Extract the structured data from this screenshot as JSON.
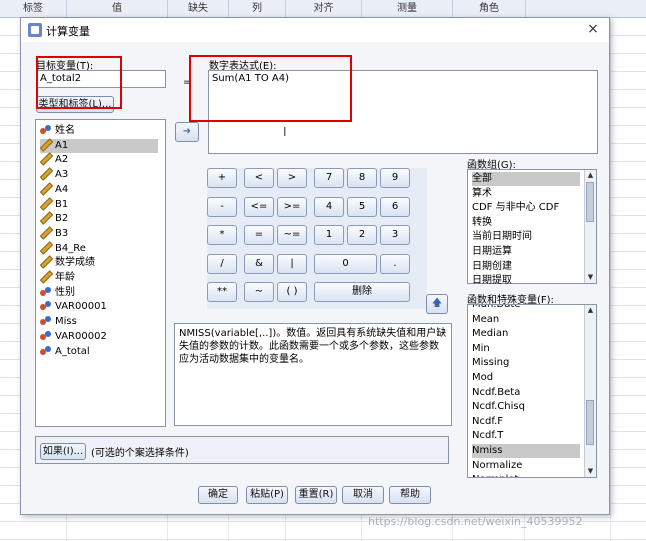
{
  "background": {
    "columns": [
      "标签",
      "值",
      "缺失",
      "列",
      "对齐",
      "测量",
      "角色"
    ]
  },
  "dialog": {
    "title": "计算变量",
    "close_icon": "×",
    "target_label": "目标变量(T):",
    "target_value": "A_total2",
    "type_label_button": "类型和标签(L)...",
    "equals": "=",
    "expression_label": "数字表达式(E):",
    "expression_value": "Sum(A1 TO A4)",
    "transfer_arrow": "➜",
    "variables": [
      {
        "name": "姓名",
        "icon": "nominal-icon",
        "selected": false
      },
      {
        "name": "A1",
        "icon": "scale-icon",
        "selected": true
      },
      {
        "name": "A2",
        "icon": "scale-icon",
        "selected": false
      },
      {
        "name": "A3",
        "icon": "scale-icon",
        "selected": false
      },
      {
        "name": "A4",
        "icon": "scale-icon",
        "selected": false
      },
      {
        "name": "B1",
        "icon": "scale-icon",
        "selected": false
      },
      {
        "name": "B2",
        "icon": "scale-icon",
        "selected": false
      },
      {
        "name": "B3",
        "icon": "scale-icon",
        "selected": false
      },
      {
        "name": "B4_Re",
        "icon": "scale-icon",
        "selected": false
      },
      {
        "name": "数学成绩",
        "icon": "scale-icon",
        "selected": false
      },
      {
        "name": "年龄",
        "icon": "scale-icon",
        "selected": false
      },
      {
        "name": "性别",
        "icon": "nominal-icon",
        "selected": false
      },
      {
        "name": "VAR00001",
        "icon": "nominal-icon",
        "selected": false
      },
      {
        "name": "Miss",
        "icon": "nominal-icon",
        "selected": false
      },
      {
        "name": "VAR00002",
        "icon": "nominal-icon",
        "selected": false
      },
      {
        "name": "A_total",
        "icon": "nominal-icon",
        "selected": false
      }
    ],
    "calculator": {
      "rows": [
        [
          "+",
          "<",
          ">",
          "7",
          "8",
          "9"
        ],
        [
          "-",
          "<=",
          ">=",
          "4",
          "5",
          "6"
        ],
        [
          "*",
          "=",
          "~=",
          "1",
          "2",
          "3"
        ],
        [
          "/",
          "&",
          "|",
          "0",
          "."
        ],
        [
          "**",
          "~",
          "( )",
          "删除"
        ]
      ]
    },
    "up_arrow": "🡅",
    "function_group_label": "函数组(G):",
    "function_groups": [
      "全部",
      "算术",
      "CDF 与非中心 CDF",
      "转换",
      "当前日期时间",
      "日期运算",
      "日期创建",
      "日期提取"
    ],
    "function_list_label": "函数和特殊变量(F):",
    "functions": [
      "Mdn.Date",
      "Mean",
      "Median",
      "Min",
      "Missing",
      "Mod",
      "Ncdf.Beta",
      "Ncdf.Chisq",
      "Ncdf.F",
      "Ncdf.T",
      "Nmiss",
      "Normalize",
      "Normplot"
    ],
    "selected_function": "Nmiss",
    "description": "NMISS(variable[,..])。数值。返回具有系统缺失值和用户缺失值的参数的计数。此函数需要一个或多个参数，这些参数应为活动数据集中的变量名。",
    "if_button": "如果(I)...",
    "if_text": "(可选的个案选择条件)",
    "footer_buttons": [
      "确定",
      "粘贴(P)",
      "重置(R)",
      "取消",
      "帮助"
    ]
  },
  "watermark": "https://blog.csdn.net/weixin_40539952"
}
